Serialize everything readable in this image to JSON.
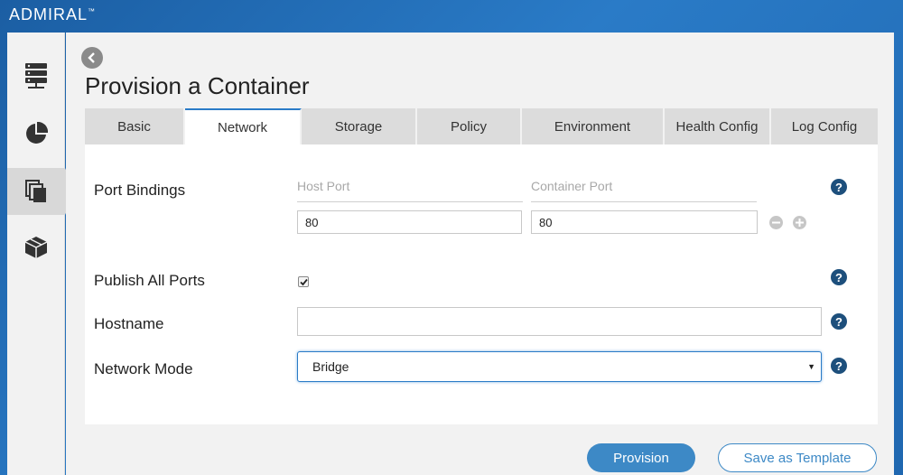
{
  "app": {
    "brand": "ADMIRAL",
    "trademark": "™"
  },
  "sidebar": {
    "items": [
      {
        "icon": "server-icon",
        "active": false
      },
      {
        "icon": "pie-chart-icon",
        "active": false
      },
      {
        "icon": "templates-icon",
        "active": true
      },
      {
        "icon": "box-icon",
        "active": false
      }
    ]
  },
  "page": {
    "title": "Provision a Container"
  },
  "tabs": [
    {
      "label": "Basic",
      "active": false
    },
    {
      "label": "Network",
      "active": true
    },
    {
      "label": "Storage",
      "active": false
    },
    {
      "label": "Policy",
      "active": false
    },
    {
      "label": "Environment",
      "active": false
    },
    {
      "label": "Health Config",
      "active": false
    },
    {
      "label": "Log Config",
      "active": false
    }
  ],
  "form": {
    "port_bindings": {
      "label": "Port Bindings",
      "host_port_header": "Host Port",
      "container_port_header": "Container Port",
      "host_port_value": "80",
      "container_port_value": "80"
    },
    "publish_all_ports": {
      "label": "Publish All Ports",
      "checked": true
    },
    "hostname": {
      "label": "Hostname",
      "value": ""
    },
    "network_mode": {
      "label": "Network Mode",
      "selected": "Bridge"
    }
  },
  "actions": {
    "provision_label": "Provision",
    "save_template_label": "Save as Template"
  },
  "colors": {
    "accent": "#2a7bc7",
    "primary_button": "#3d89c6",
    "help_icon": "#1d4f7c"
  }
}
